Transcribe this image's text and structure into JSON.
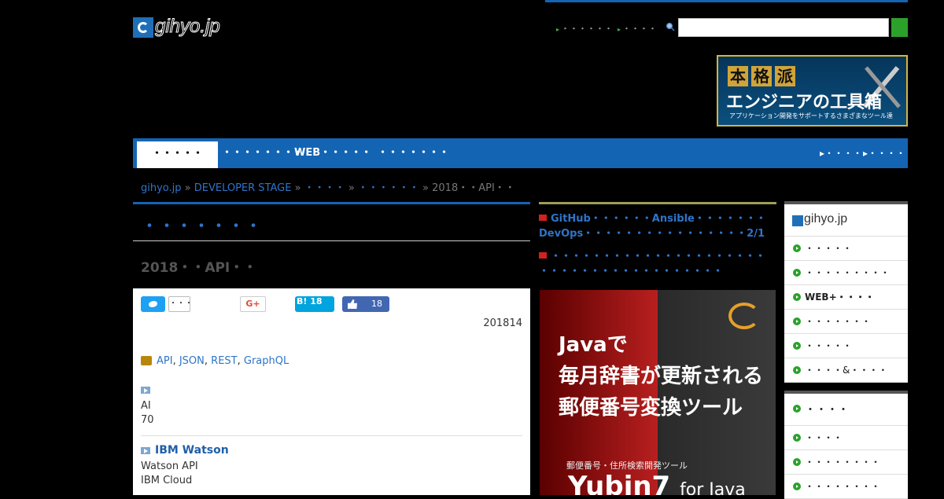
{
  "header": {
    "logo_text": "gihyo.jp",
    "links": [
      "・・・・・・",
      "・・・・"
    ],
    "search": {
      "placeholder": ""
    },
    "banner": {
      "line1": [
        "本",
        "格",
        "派"
      ],
      "line2": "エンジニアの工具箱",
      "line3": "アプリケーション開発をサポートするさまざまなツール達"
    }
  },
  "nav": {
    "tabs": [
      "・・・・・",
      "・・・・・・・・・",
      "WEB・・・・・",
      "・・・・・・・"
    ],
    "right": [
      "・・・・",
      "・・・・"
    ]
  },
  "breadcrumb": {
    "items": [
      "gihyo.jp",
      "DEVELOPER STAGE",
      "・・・・",
      "・・・・・・"
    ],
    "current": "2018・・API・・"
  },
  "article": {
    "section_title": "・・・・・・・",
    "title": "2018・・API・・",
    "share": {
      "tw_count": "・・・",
      "gplus": "G+",
      "hatena": "B!",
      "hatena_count": "18",
      "fb_count": "18"
    },
    "date": "201814",
    "tags": [
      "API",
      "JSON",
      "REST",
      "GraphQL"
    ],
    "block1": {
      "line1": "AI",
      "line2": "70"
    },
    "block2": {
      "title": "IBM Watson",
      "line1": "Watson API",
      "line2": "IBM Cloud"
    }
  },
  "news": [
    {
      "line1": "GitHub・・・・・・Ansible・・・・・・・",
      "line2": "DevOps・・・・・・・・・・・・・・・・2/1"
    },
    {
      "line1": "・・・・・・・・・・・・・・・・・・・・・",
      "line2": "・・・・・・・・・・・・・・・・・・"
    }
  ],
  "ad": {
    "line1": "Javaで",
    "line2": "毎月辞書が更新される",
    "line3": "郵便番号変換ツール",
    "sub": "郵便番号・住所検索開発ツール",
    "product": "Yubin7",
    "product_suffix": "for Java"
  },
  "sidebar": {
    "box1_logo": "gihyo.jp",
    "box1_items": [
      "・・・・・",
      "・・・・・・・・・",
      "WEB+・・・・",
      "・・・・・・・",
      "・・・・・",
      "・・・・&・・・・"
    ],
    "box2_title": "・・・・",
    "box2_items": [
      "・・・・",
      "・・・・・・・・",
      "・・・・・・・・"
    ]
  },
  "colors": {
    "brand_blue": "#1464b4",
    "link_blue": "#2f74c8",
    "green": "#2ba12b"
  }
}
